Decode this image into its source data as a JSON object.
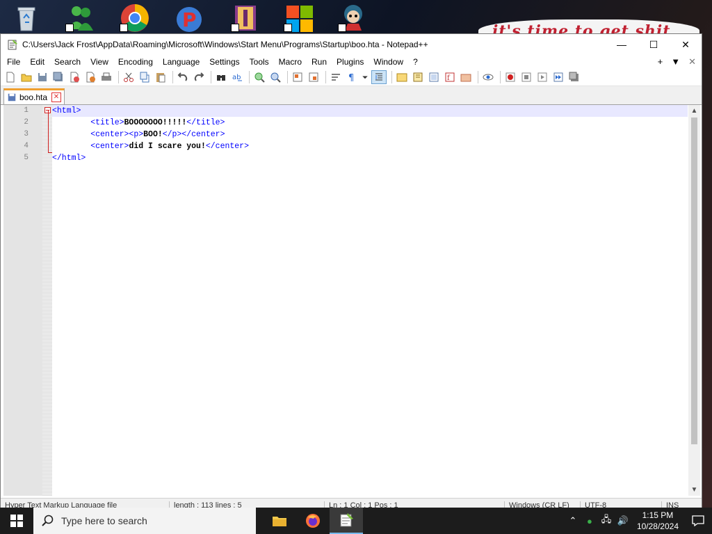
{
  "banner": {
    "text": "it's time to get shit"
  },
  "window": {
    "title": "C:\\Users\\Jack Frost\\AppData\\Roaming\\Microsoft\\Windows\\Start Menu\\Programs\\Startup\\boo.hta - Notepad++",
    "controls": {
      "minimize": "—",
      "maximize": "☐",
      "close": "✕"
    }
  },
  "menu": {
    "items": [
      "File",
      "Edit",
      "Search",
      "View",
      "Encoding",
      "Language",
      "Settings",
      "Tools",
      "Macro",
      "Run",
      "Plugins",
      "Window",
      "?"
    ],
    "right": {
      "add": "+",
      "dropdown": "▼",
      "close": "✕"
    }
  },
  "tab": {
    "label": "boo.hta",
    "close": "✕"
  },
  "editor": {
    "lines": [
      {
        "num": "1",
        "parts": [
          {
            "t": "<html>",
            "c": "tag"
          }
        ]
      },
      {
        "num": "2",
        "parts": [
          {
            "t": "        ",
            "c": "txt"
          },
          {
            "t": "<title>",
            "c": "tag"
          },
          {
            "t": "BOOOOOOO!!!!!",
            "c": "txt"
          },
          {
            "t": "</title>",
            "c": "tag"
          }
        ]
      },
      {
        "num": "3",
        "parts": [
          {
            "t": "        ",
            "c": "txt"
          },
          {
            "t": "<center><p>",
            "c": "tag"
          },
          {
            "t": "BOO!",
            "c": "txt"
          },
          {
            "t": "</p></center>",
            "c": "tag"
          }
        ]
      },
      {
        "num": "4",
        "parts": [
          {
            "t": "        ",
            "c": "txt"
          },
          {
            "t": "<center>",
            "c": "tag"
          },
          {
            "t": "did I scare you!",
            "c": "txt"
          },
          {
            "t": "</center>",
            "c": "tag"
          }
        ]
      },
      {
        "num": "5",
        "parts": [
          {
            "t": "</html>",
            "c": "tag"
          }
        ]
      }
    ]
  },
  "status": {
    "type": "Hyper Text Markup Language file",
    "length": "length : 113    lines : 5",
    "position": "Ln : 1    Col : 1    Pos : 1",
    "eol": "Windows (CR LF)",
    "encoding": "UTF-8",
    "mode": "INS"
  },
  "taskbar": {
    "search_placeholder": "Type here to search",
    "time": "1:15 PM",
    "date": "10/28/2024"
  }
}
